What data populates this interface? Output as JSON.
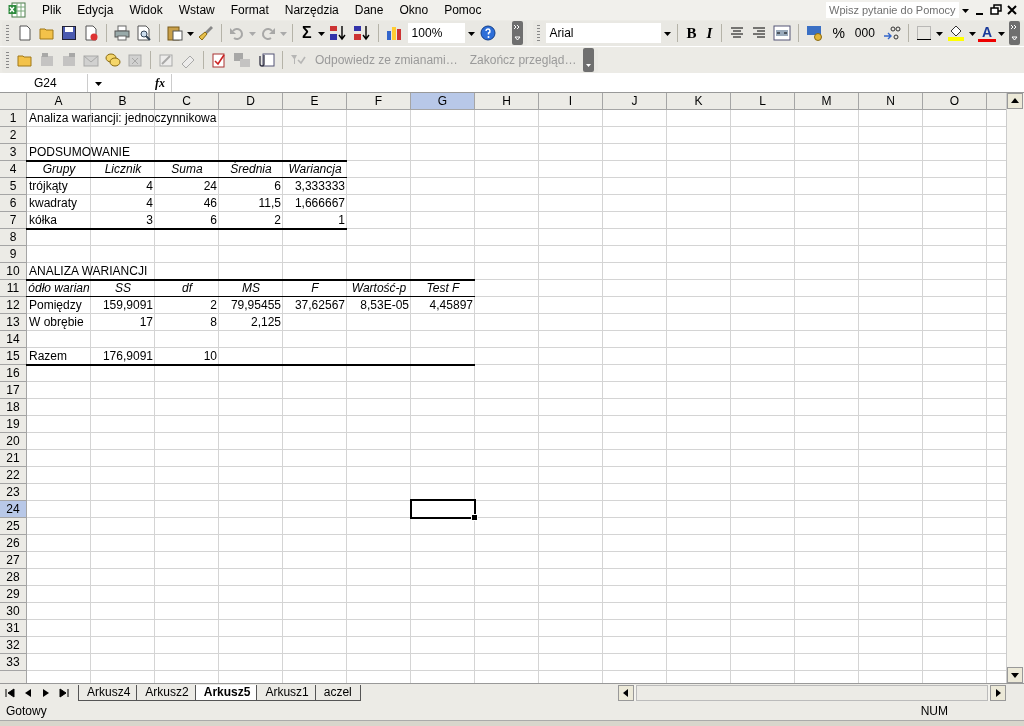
{
  "window": {
    "help_placeholder": "Wpisz pytanie do Pomocy"
  },
  "menu": [
    {
      "label": "Plik"
    },
    {
      "label": "Edycja"
    },
    {
      "label": "Widok"
    },
    {
      "label": "Wstaw"
    },
    {
      "label": "Format"
    },
    {
      "label": "Narzędzia"
    },
    {
      "label": "Dane"
    },
    {
      "label": "Okno"
    },
    {
      "label": "Pomoc"
    }
  ],
  "standard_toolbar": {
    "sum_symbol": "Σ",
    "zoom": "100%"
  },
  "formatting_toolbar": {
    "font": "Arial",
    "bold": "B",
    "italic": "I",
    "percent": "%",
    "thousands": "000",
    "font_color": "A"
  },
  "reviewing_toolbar": {
    "buttons": [
      {
        "label": "Odpowiedz ze zmianami…",
        "disabled": true
      },
      {
        "label": "Zakończ przegląd…",
        "disabled": true
      }
    ]
  },
  "formula_bar": {
    "name_box": "G24",
    "function_label": "fx"
  },
  "sheet": {
    "columns": [
      {
        "label": "A",
        "selected": false
      },
      {
        "label": "B",
        "selected": false
      },
      {
        "label": "C",
        "selected": false
      },
      {
        "label": "D",
        "selected": false
      },
      {
        "label": "E",
        "selected": false
      },
      {
        "label": "F",
        "selected": false
      },
      {
        "label": "G",
        "selected": true
      },
      {
        "label": "H",
        "selected": false
      },
      {
        "label": "I",
        "selected": false
      },
      {
        "label": "J",
        "selected": false
      },
      {
        "label": "K",
        "selected": false
      },
      {
        "label": "L",
        "selected": false
      },
      {
        "label": "M",
        "selected": false
      },
      {
        "label": "N",
        "selected": false
      },
      {
        "label": "O",
        "selected": false
      }
    ],
    "rows": [
      {
        "label": "1",
        "selected": false,
        "cells": [
          {
            "text": "Analiza wariancji: jednoczynnikowa",
            "kind": "label",
            "bottom_border": false
          }
        ]
      },
      {
        "label": "2",
        "selected": false,
        "cells": []
      },
      {
        "label": "3",
        "selected": false,
        "cells": [
          {
            "text": "PODSUMOWANIE",
            "kind": "label",
            "bottom_border": true
          },
          {
            "kind": "blank",
            "bottom_border": true
          },
          {
            "kind": "blank",
            "bottom_border": true
          },
          {
            "kind": "blank",
            "bottom_border": true
          },
          {
            "kind": "blank",
            "bottom_border": true
          }
        ]
      },
      {
        "label": "4",
        "selected": false,
        "cells": [
          {
            "text": "Grupy",
            "kind": "header",
            "bottom_border": true
          },
          {
            "text": "Licznik",
            "kind": "header",
            "bottom_border": true
          },
          {
            "text": "Suma",
            "kind": "header",
            "bottom_border": true
          },
          {
            "text": "Średnia",
            "kind": "header",
            "bottom_border": true
          },
          {
            "text": "Wariancja",
            "kind": "header",
            "bottom_border": true
          }
        ]
      },
      {
        "label": "5",
        "selected": false,
        "cells": [
          {
            "text": "trójkąty",
            "kind": "label",
            "bottom_border": false
          },
          {
            "text": "4",
            "kind": "number",
            "bottom_border": false
          },
          {
            "text": "24",
            "kind": "number",
            "bottom_border": false
          },
          {
            "text": "6",
            "kind": "number",
            "bottom_border": false
          },
          {
            "text": "3,333333",
            "kind": "number",
            "bottom_border": false
          }
        ]
      },
      {
        "label": "6",
        "selected": false,
        "cells": [
          {
            "text": "kwadraty",
            "kind": "label",
            "bottom_border": false
          },
          {
            "text": "4",
            "kind": "number",
            "bottom_border": false
          },
          {
            "text": "46",
            "kind": "number",
            "bottom_border": false
          },
          {
            "text": "11,5",
            "kind": "number",
            "bottom_border": false
          },
          {
            "text": "1,666667",
            "kind": "number",
            "bottom_border": false
          }
        ]
      },
      {
        "label": "7",
        "selected": false,
        "cells": [
          {
            "text": "kółka",
            "kind": "label",
            "bottom_border": true
          },
          {
            "text": "3",
            "kind": "number",
            "bottom_border": true
          },
          {
            "text": "6",
            "kind": "number",
            "bottom_border": true
          },
          {
            "text": "2",
            "kind": "number",
            "bottom_border": true
          },
          {
            "text": "1",
            "kind": "number",
            "bottom_border": true
          }
        ]
      },
      {
        "label": "8",
        "selected": false,
        "cells": []
      },
      {
        "label": "9",
        "selected": false,
        "cells": []
      },
      {
        "label": "10",
        "selected": false,
        "cells": [
          {
            "text": "ANALIZA WARIANCJI",
            "kind": "label",
            "bottom_border": true
          },
          {
            "kind": "blank",
            "bottom_border": true
          },
          {
            "kind": "blank",
            "bottom_border": true
          },
          {
            "kind": "blank",
            "bottom_border": true
          },
          {
            "kind": "blank",
            "bottom_border": true
          },
          {
            "kind": "blank",
            "bottom_border": true
          },
          {
            "kind": "blank",
            "bottom_border": true
          }
        ]
      },
      {
        "label": "11",
        "selected": false,
        "cells": [
          {
            "text": "ódło warian",
            "kind": "header",
            "bottom_border": true
          },
          {
            "text": "SS",
            "kind": "header",
            "bottom_border": true
          },
          {
            "text": "df",
            "kind": "header",
            "bottom_border": true
          },
          {
            "text": "MS",
            "kind": "header",
            "bottom_border": true
          },
          {
            "text": "F",
            "kind": "header",
            "bottom_border": true
          },
          {
            "text": "Wartość-p",
            "kind": "header",
            "bottom_border": true
          },
          {
            "text": "Test F",
            "kind": "header",
            "bottom_border": true
          }
        ]
      },
      {
        "label": "12",
        "selected": false,
        "cells": [
          {
            "text": "Pomiędzy",
            "kind": "label",
            "bottom_border": false
          },
          {
            "text": "159,9091",
            "kind": "number",
            "bottom_border": false
          },
          {
            "text": "2",
            "kind": "number",
            "bottom_border": false
          },
          {
            "text": "79,95455",
            "kind": "number",
            "bottom_border": false
          },
          {
            "text": "37,62567",
            "kind": "number",
            "bottom_border": false
          },
          {
            "text": "8,53E-05",
            "kind": "number",
            "bottom_border": false
          },
          {
            "text": "4,45897",
            "kind": "number",
            "bottom_border": false
          }
        ]
      },
      {
        "label": "13",
        "selected": false,
        "cells": [
          {
            "text": "W obrębie",
            "kind": "label",
            "bottom_border": false
          },
          {
            "text": "17",
            "kind": "number",
            "bottom_border": false
          },
          {
            "text": "8",
            "kind": "number",
            "bottom_border": false
          },
          {
            "text": "2,125",
            "kind": "number",
            "bottom_border": false
          }
        ]
      },
      {
        "label": "14",
        "selected": false,
        "cells": []
      },
      {
        "label": "15",
        "selected": false,
        "cells": [
          {
            "text": "Razem",
            "kind": "label",
            "bottom_border": true
          },
          {
            "text": "176,9091",
            "kind": "number",
            "bottom_border": true
          },
          {
            "text": "10",
            "kind": "number",
            "bottom_border": true
          },
          {
            "kind": "blank",
            "bottom_border": true
          },
          {
            "kind": "blank",
            "bottom_border": true
          },
          {
            "kind": "blank",
            "bottom_border": true
          },
          {
            "kind": "blank",
            "bottom_border": true
          }
        ]
      },
      {
        "label": "16",
        "selected": false,
        "cells": []
      },
      {
        "label": "17",
        "selected": false,
        "cells": []
      },
      {
        "label": "18",
        "selected": false,
        "cells": []
      },
      {
        "label": "19",
        "selected": false,
        "cells": []
      },
      {
        "label": "20",
        "selected": false,
        "cells": []
      },
      {
        "label": "21",
        "selected": false,
        "cells": []
      },
      {
        "label": "22",
        "selected": false,
        "cells": []
      },
      {
        "label": "23",
        "selected": false,
        "cells": []
      },
      {
        "label": "24",
        "selected": true,
        "cells": []
      },
      {
        "label": "25",
        "selected": false,
        "cells": []
      },
      {
        "label": "26",
        "selected": false,
        "cells": []
      },
      {
        "label": "27",
        "selected": false,
        "cells": []
      },
      {
        "label": "28",
        "selected": false,
        "cells": []
      },
      {
        "label": "29",
        "selected": false,
        "cells": []
      },
      {
        "label": "30",
        "selected": false,
        "cells": []
      },
      {
        "label": "31",
        "selected": false,
        "cells": []
      },
      {
        "label": "32",
        "selected": false,
        "cells": []
      },
      {
        "label": "33",
        "selected": false,
        "cells": []
      }
    ]
  },
  "sheet_tabs": [
    {
      "label": "Arkusz4",
      "selected": false
    },
    {
      "label": "Arkusz2",
      "selected": false
    },
    {
      "label": "Arkusz5",
      "selected": true
    },
    {
      "label": "Arkusz1",
      "selected": false
    },
    {
      "label": "aczel",
      "selected": false
    }
  ],
  "status_bar": {
    "status": "Gotowy",
    "num_lock": "NUM"
  }
}
